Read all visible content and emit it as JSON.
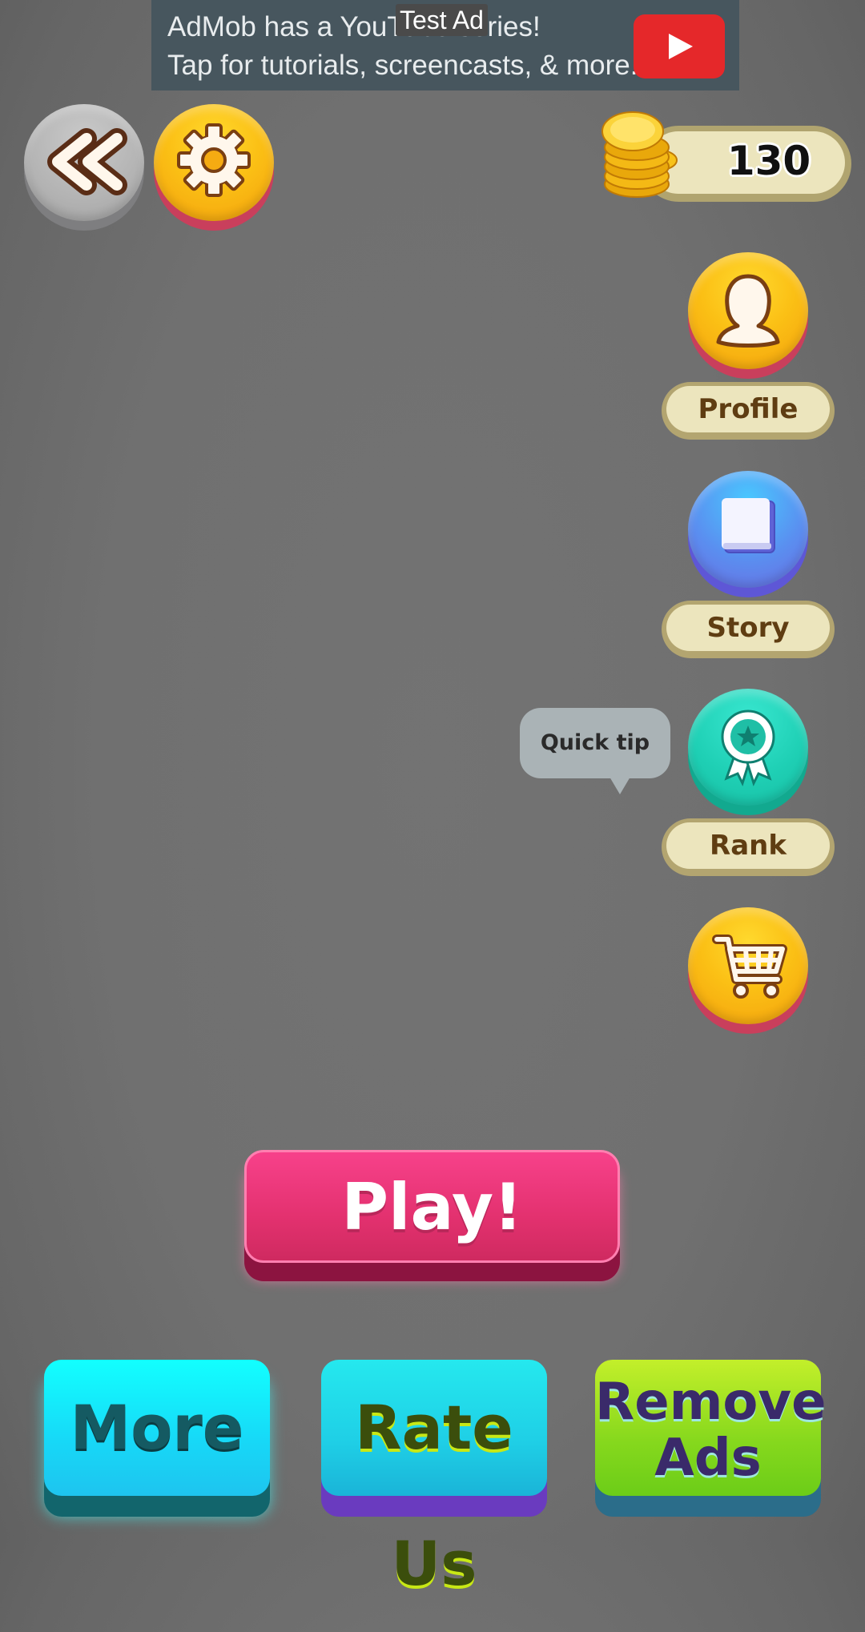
{
  "ad": {
    "line1": "AdMob has a YouTube series!",
    "line2": "Tap for tutorials, screencasts, & more.",
    "badge": "Test Ad",
    "icon": "youtube-play-icon"
  },
  "toolbar": {
    "back_icon": "double-chevron-left-icon",
    "settings_icon": "gear-icon"
  },
  "coins": {
    "icon": "coin-stack-icon",
    "count": "130"
  },
  "menu": {
    "profile": {
      "label": "Profile",
      "icon": "user-silhouette-icon"
    },
    "story": {
      "label": "Story",
      "icon": "book-icon"
    },
    "rank": {
      "label": "Rank",
      "icon": "award-ribbon-icon"
    },
    "shop": {
      "icon": "shopping-cart-icon"
    }
  },
  "tip": {
    "text": "Quick tip"
  },
  "play": {
    "label": "Play!"
  },
  "bottom": {
    "more": "More",
    "rate": "Rate Us",
    "remove_line1": "Remove",
    "remove_line2": "Ads"
  },
  "colors": {
    "background": "#707070",
    "play": "#e3316f",
    "more": "#17d8f7",
    "rate": "#1fcfe6",
    "remove": "#86d81d"
  }
}
